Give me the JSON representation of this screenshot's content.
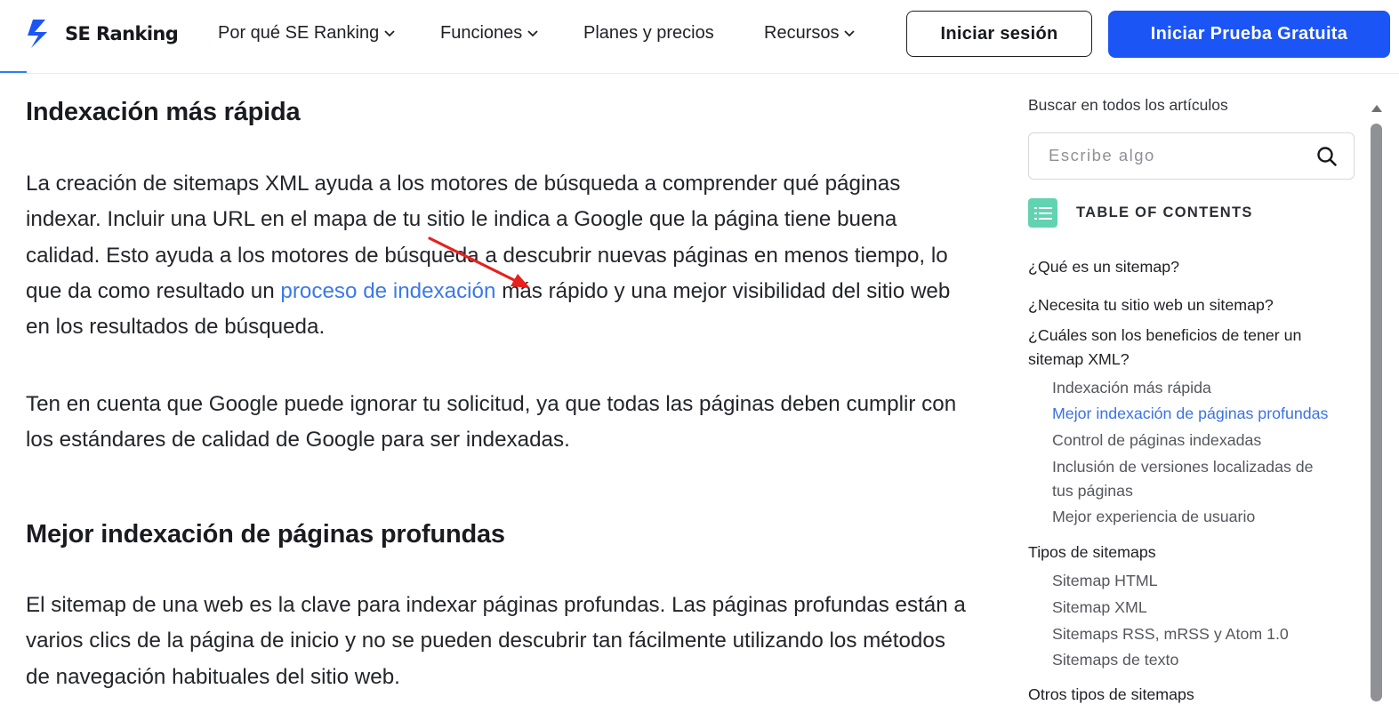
{
  "header": {
    "logo_text": "SE Ranking",
    "nav": [
      {
        "label": "Por qué SE Ranking",
        "has_dropdown": true
      },
      {
        "label": "Funciones",
        "has_dropdown": true
      },
      {
        "label": "Planes y precios",
        "has_dropdown": false
      },
      {
        "label": "Recursos",
        "has_dropdown": true
      }
    ],
    "login_label": "Iniciar sesión",
    "trial_label": "Iniciar Prueba Gratuita",
    "brand_color": "#1b55f5"
  },
  "article": {
    "heading_1": "Indexación más rápida",
    "para_1_before": "La creación de sitemaps XML ayuda a los motores de búsqueda a comprender qué páginas indexar. Incluir una URL en el mapa de tu sitio le indica a Google que la página tiene buena calidad. Esto ayuda a los motores de búsqueda a descubrir nuevas páginas en menos tiempo, lo que da como resultado un ",
    "para_1_link": "proceso de indexación",
    "para_1_after": " más rápido y una mejor visibilidad del sitio web en los resultados de búsqueda.",
    "para_2": "Ten en cuenta que Google puede ignorar tu solicitud, ya que todas las páginas deben cumplir con los estándares de calidad de Google para ser indexadas.",
    "heading_2": "Mejor indexación de páginas profundas",
    "para_3": "El sitemap de una web es la clave para indexar páginas profundas. Las páginas profundas están a varios clics de la página de inicio y no se pueden descubrir tan fácilmente utilizando los métodos de navegación habituales del sitio web.",
    "link_color": "#3c79e8",
    "annotation_arrow_color": "#e8201c"
  },
  "sidebar": {
    "search_label": "Buscar en todos los artículos",
    "search_placeholder": "Escribe algo",
    "toc_title": "TABLE OF CONTENTS",
    "toc": {
      "item_1": "¿Qué es un sitemap?",
      "item_2": "¿Necesita tu sitio web un sitemap?",
      "item_3_line1": "¿Cuáles son los beneficios de tener un",
      "item_3_line2": "sitemap XML?",
      "sub_1": "Indexación más rápida",
      "sub_2": "Mejor indexación de páginas profundas",
      "sub_3": "Control de páginas indexadas",
      "sub_4_line1": "Inclusión de versiones localizadas de",
      "sub_4_line2": "tus páginas",
      "sub_5": "Mejor experiencia de usuario",
      "item_4": "Tipos de sitemaps",
      "sub_6": "Sitemap HTML",
      "sub_7": "Sitemap XML",
      "sub_8": "Sitemaps RSS, mRSS y Atom 1.0",
      "sub_9": "Sitemaps de texto",
      "item_5": "Otros tipos de sitemaps",
      "active_item": "Mejor indexación de páginas profundas"
    }
  }
}
